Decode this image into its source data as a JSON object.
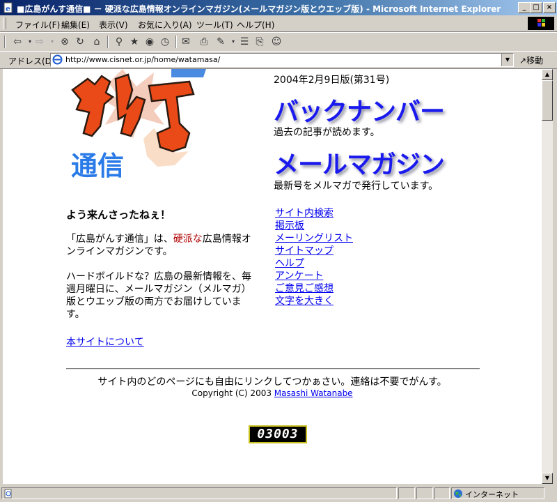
{
  "window": {
    "title": "■広島がんす通信■ － 硬派な広島情報オンラインマガジン(メールマガジン版とウエッブ版) - Microsoft Internet Explorer",
    "min_label": "_",
    "max_label": "□",
    "close_label": "×"
  },
  "menu": {
    "items": [
      "ファイル(F)",
      "編集(E)",
      "表示(V)",
      "お気に入り(A)",
      "ツール(T)",
      "ヘルプ(H)"
    ]
  },
  "address": {
    "label": "アドレス(D)",
    "url": "http://www.cisnet.or.jp/home/watamasa/",
    "go_label": "移動"
  },
  "page": {
    "logo_text_1": "がんす",
    "logo_text_2": "通信",
    "logo_text_top": "広島",
    "issue_date": "2004年2月9日版(第31号)",
    "backnumber_heading": "バックナンバー",
    "backnumber_desc": "過去の記事が読めます。",
    "mailmag_heading": "メールマガジン",
    "mailmag_desc": "最新号をメルマガで発行しています。",
    "welcome": "よう来んさったねぇ！",
    "intro_part1": "「広島がんす通信」は、",
    "intro_red": "硬派な",
    "intro_part2": "広島情報オンラインマガジンです。",
    "intro2": "ハードボイルドな？広島の最新情報を、毎週月曜日に、メールマガジン（メルマガ）版とウエッブ版の両方でお届けしています。",
    "about_link": "本サイトについて",
    "links": [
      "サイト内検索",
      "掲示板",
      "メーリングリスト",
      "サイトマップ",
      "ヘルプ",
      "アンケート",
      "ご意見ご感想",
      "文字を大きく"
    ],
    "footer_notice": "サイト内のどのページにも自由にリンクしてつかぁさい。連絡は不要でがんす。",
    "copyright_prefix": "Copyright (C) 2003 ",
    "copyright_name": "Masashi Watanabe",
    "counter": "03003"
  },
  "status": {
    "zone": "インターネット"
  },
  "colors": {
    "link": "#0000ee",
    "heading_blue": "#1a1aee",
    "accent_red": "#b00000"
  }
}
